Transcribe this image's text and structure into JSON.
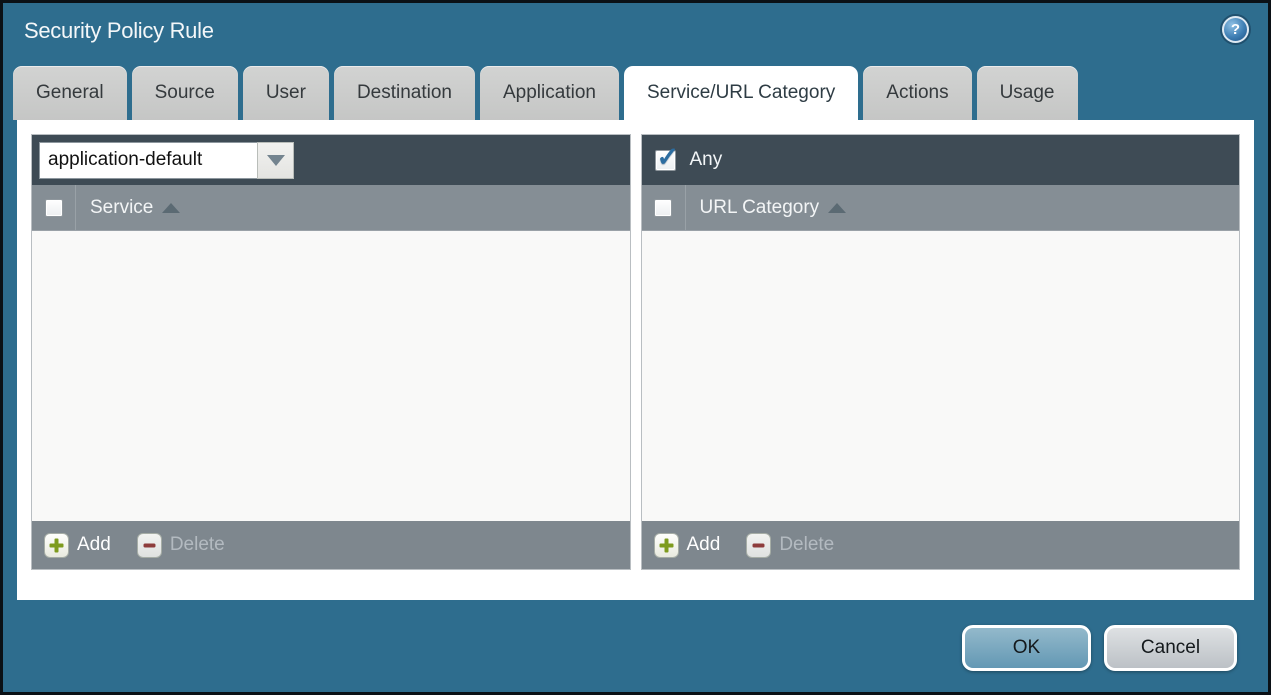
{
  "window": {
    "title": "Security Policy Rule",
    "help_icon": "?"
  },
  "tabs": [
    {
      "label": "General",
      "active": false
    },
    {
      "label": "Source",
      "active": false
    },
    {
      "label": "User",
      "active": false
    },
    {
      "label": "Destination",
      "active": false
    },
    {
      "label": "Application",
      "active": false
    },
    {
      "label": "Service/URL Category",
      "active": true
    },
    {
      "label": "Actions",
      "active": false
    },
    {
      "label": "Usage",
      "active": false
    }
  ],
  "service_panel": {
    "dropdown": {
      "value": "application-default",
      "icon": "chevron-down-icon"
    },
    "column": {
      "header": "Service",
      "sort": "ascending",
      "checkbox_checked": false
    },
    "rows": [],
    "footer": {
      "add_label": "Add",
      "delete_label": "Delete",
      "delete_enabled": false
    }
  },
  "url_category_panel": {
    "any_row": {
      "label": "Any",
      "checked": true
    },
    "column": {
      "header": "URL Category",
      "sort": "ascending",
      "checkbox_checked": false
    },
    "rows": [],
    "footer": {
      "add_label": "Add",
      "delete_label": "Delete",
      "delete_enabled": false
    }
  },
  "actions": {
    "ok_label": "OK",
    "cancel_label": "Cancel"
  },
  "colors": {
    "dialog_background": "#2e6d8e",
    "panel_header_dark": "#3e4b55",
    "column_header_gray": "#858e95",
    "footer_gray": "#7e878e",
    "tab_inactive": "#c9caca",
    "tab_active": "#ffffff",
    "ok_button": "#6398b4",
    "cancel_button": "#c3c7cb",
    "add_plus_green": "#7e9b1e",
    "delete_minus_red": "#8e3d3c",
    "check_blue": "#2c6da0"
  }
}
